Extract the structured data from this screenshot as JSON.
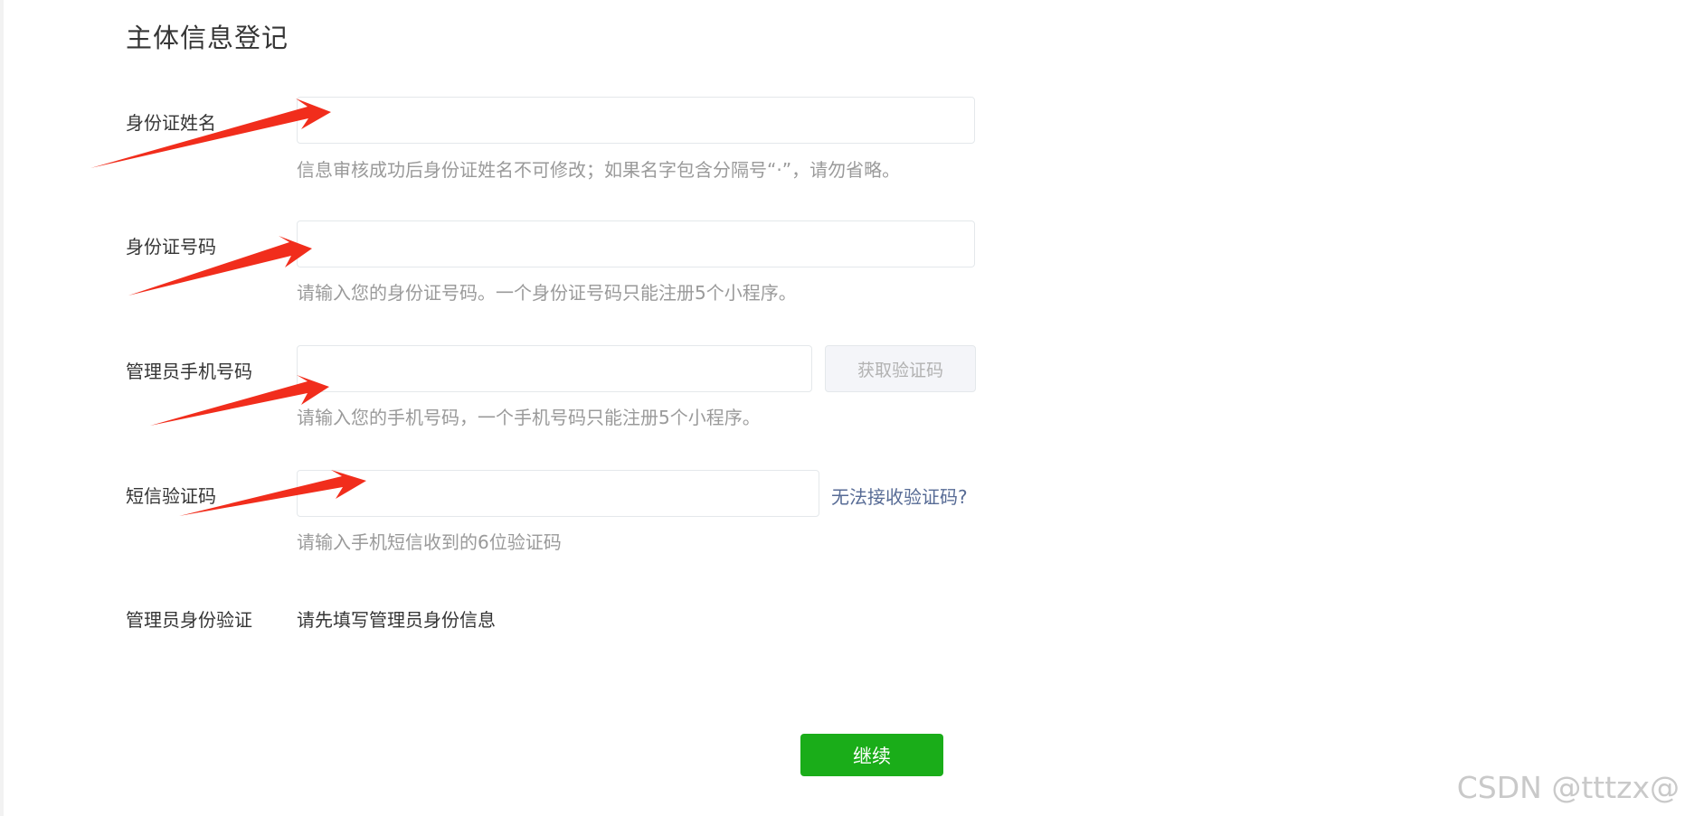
{
  "page": {
    "title": "主体信息登记"
  },
  "form": {
    "id_name": {
      "label": "身份证姓名",
      "value": "",
      "hint": "信息审核成功后身份证姓名不可修改；如果名字包含分隔号“·”，请勿省略。"
    },
    "id_number": {
      "label": "身份证号码",
      "value": "",
      "hint": "请输入您的身份证号码。一个身份证号码只能注册5个小程序。"
    },
    "admin_phone": {
      "label": "管理员手机号码",
      "value": "",
      "button_label": "获取验证码",
      "hint": "请输入您的手机号码，一个手机号码只能注册5个小程序。"
    },
    "sms_code": {
      "label": "短信验证码",
      "value": "",
      "link_label": "无法接收验证码?",
      "hint": "请输入手机短信收到的6位验证码"
    },
    "admin_verify": {
      "label": "管理员身份验证",
      "value": "请先填写管理员身份信息"
    }
  },
  "actions": {
    "continue_label": "继续"
  },
  "watermark": {
    "text": "CSDN @tttzx@"
  },
  "colors": {
    "primary_green": "#1aad19",
    "link_blue": "#576b95",
    "annotation_red": "#f12d1c",
    "hint_gray": "#9a9a9a"
  }
}
